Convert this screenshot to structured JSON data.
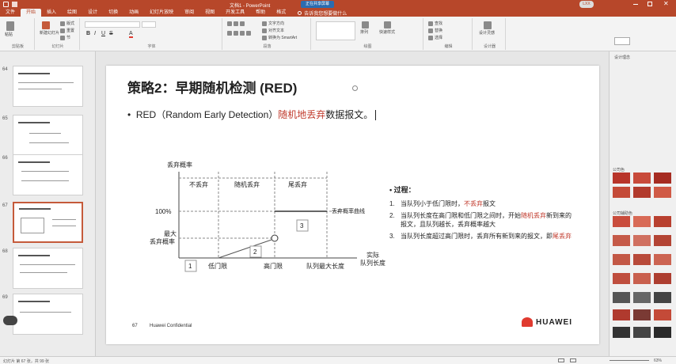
{
  "window": {
    "title": "文档1 - PowerPoint",
    "share_label": "正在共享屏幕",
    "user_initials": "LXX"
  },
  "tabs": [
    "文件",
    "开始",
    "插入",
    "绘图",
    "设计",
    "切换",
    "动画",
    "幻灯片放映",
    "审阅",
    "视图",
    "开发工具",
    "帮助",
    "格式"
  ],
  "active_tab": "开始",
  "tell_me": "告诉我您想要做什么",
  "ribbon": {
    "groups": [
      "剪贴板",
      "幻灯片",
      "字体",
      "段落",
      "绘图",
      "编辑",
      "设计器"
    ],
    "buttons": [
      "粘贴",
      "新建幻灯片",
      "版式",
      "重置",
      "节",
      "文字方向",
      "对齐文本",
      "转换为 SmartArt",
      "形状",
      "排列",
      "快速样式",
      "查找",
      "替换",
      "选择",
      "设计灵感"
    ]
  },
  "thumbnails": [
    {
      "num": "64"
    },
    {
      "num": "65"
    },
    {
      "num": "66"
    },
    {
      "num": "67"
    },
    {
      "num": "68"
    },
    {
      "num": "69"
    }
  ],
  "slide": {
    "title": "策略2：早期随机检测 (RED)",
    "bullet_prefix": "RED（Random Early Detection）",
    "bullet_highlight": "随机地丢弃",
    "bullet_suffix": "数据报文。",
    "footer_page": "67",
    "footer_conf": "Huawei Confidential",
    "logo_text": "HUAWEI",
    "chart": {
      "y_axis_label": "丢弃概率",
      "region_labels": [
        "不丢弃",
        "随机丢弃",
        "尾丢弃"
      ],
      "y_100": "100%",
      "y_max": "最大\n丢弃概率",
      "curve_label": "丢弃概率曲线",
      "x_labels": [
        "低门限",
        "高门限",
        "队列最大长度"
      ],
      "x_axis_label": "实际\n队列长度",
      "markers": [
        "1",
        "2",
        "3"
      ]
    },
    "process": {
      "title": "过程：",
      "items": [
        {
          "num": "1.",
          "text_before": "当队列小于低门限时，",
          "highlight": "不丢弃",
          "text_after": "报文"
        },
        {
          "num": "2.",
          "text_before": "当队列长度在高门限和低门限之间时，开始",
          "highlight": "随机丢弃",
          "text_after": "新到来的报文，且队列越长，丢弃概率越大"
        },
        {
          "num": "3.",
          "text_before": "当队列长度超过高门限时，丢弃所有新到来的报文，即",
          "highlight": "尾丢弃",
          "text_after": ""
        }
      ]
    }
  },
  "right_panel": {
    "header": "设计理念",
    "label1": "公司色",
    "label2": "公司辅助色"
  },
  "status": {
    "slide_info": "幻灯片 第 67 张，共 99 张",
    "zoom": "63%"
  },
  "colors": {
    "brand": "#b7472a",
    "highlight": "#c0392b",
    "accent_red": "#e03a2f"
  }
}
